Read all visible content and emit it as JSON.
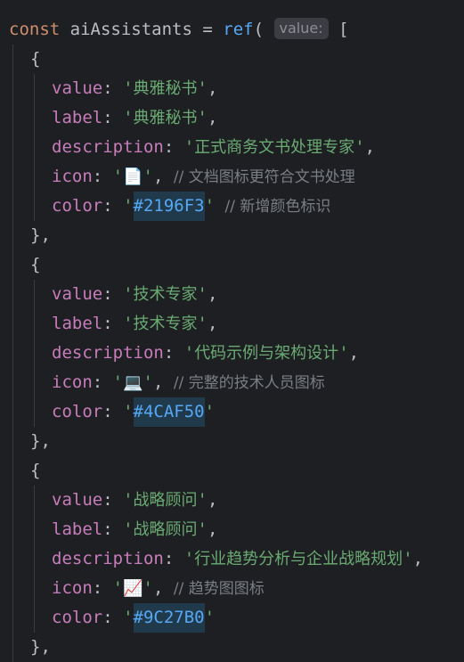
{
  "code": {
    "decl": {
      "keyword": "const",
      "name": "aiAssistants",
      "op": "=",
      "fn": "ref",
      "paren": "(",
      "hint": "value:",
      "bracket": "["
    },
    "props": {
      "value": "value",
      "label": "label",
      "description": "description",
      "icon": "icon",
      "color": "color"
    },
    "items": [
      {
        "value": "典雅秘书",
        "label": "典雅秘书",
        "description": "正式商务文书处理专家",
        "icon": "📄",
        "icon_comment": "// 文档图标更符合文书处理",
        "color": "#2196F3",
        "color_comment": "// 新增颜色标识"
      },
      {
        "value": "技术专家",
        "label": "技术专家",
        "description": "代码示例与架构设计",
        "icon": "💻",
        "icon_comment": "// 完整的技术人员图标",
        "color": "#4CAF50",
        "color_comment": ""
      },
      {
        "value": "战略顾问",
        "label": "战略顾问",
        "description": "行业趋势分析与企业战略规划",
        "icon": "📈",
        "icon_comment": "// 趋势图图标",
        "color": "#9C27B0",
        "color_comment": ""
      }
    ]
  },
  "theme": {
    "background": "#1e1f22",
    "keyword": "#cf8e6d",
    "function": "#56a8f5",
    "property": "#c77dbb",
    "string": "#6aab73",
    "comment": "#7a7e85"
  }
}
